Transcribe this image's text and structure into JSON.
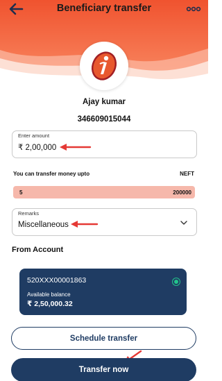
{
  "header": {
    "title": "Beneficiary transfer",
    "back_icon": "arrow-left-icon",
    "more_icon": "more-dots-icon",
    "bg_color": "#f36b45"
  },
  "beneficiary": {
    "name": "Ajay kumar",
    "account_number": "346609015044",
    "bank_logo_icon": "bank-logo-icon"
  },
  "amount": {
    "label": "Enter amount",
    "value": "₹ 2,00,000"
  },
  "limit": {
    "text": "You can transfer money upto",
    "mode": "NEFT",
    "min": "5",
    "max": "200000"
  },
  "remarks": {
    "label": "Remarks",
    "value": "Miscellaneous"
  },
  "from_account": {
    "section_title": "From Account",
    "account_number": "520XXX00001863",
    "balance_label": "Available balance",
    "balance_value": "₹ 2,50,000.32",
    "selected": true
  },
  "buttons": {
    "schedule": "Schedule transfer",
    "transfer": "Transfer now"
  },
  "colors": {
    "primary": "#1f3c63",
    "accent": "#f36b45",
    "annotation": "#e53935",
    "range": "#f6b8ab",
    "selected": "#22c48b"
  }
}
